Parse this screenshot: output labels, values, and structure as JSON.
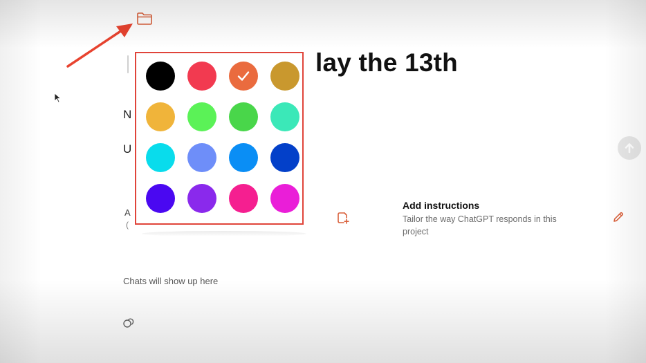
{
  "header": {
    "folder_icon": "folder-icon",
    "accent_color": "#d9603b"
  },
  "project": {
    "title_visible": "lay the 13th",
    "peek_1": "N",
    "peek_2": "U",
    "peek_3": "A",
    "peek_4": "("
  },
  "color_picker": {
    "selected_index": 2,
    "swatches": [
      {
        "color": "#000000"
      },
      {
        "color": "#f23a50"
      },
      {
        "color": "#ea6b3e"
      },
      {
        "color": "#c9982e"
      },
      {
        "color": "#f0b43a"
      },
      {
        "color": "#5bf257"
      },
      {
        "color": "#49d64a"
      },
      {
        "color": "#3be8b8"
      },
      {
        "color": "#09dcec"
      },
      {
        "color": "#6e8ef9"
      },
      {
        "color": "#0a8ef5"
      },
      {
        "color": "#0340c9"
      },
      {
        "color": "#4a08f1"
      },
      {
        "color": "#8a29ec"
      },
      {
        "color": "#f51f90"
      },
      {
        "color": "#ea1ed8"
      }
    ],
    "border_color": "#e0443a"
  },
  "instructions": {
    "title": "Add instructions",
    "description": "Tailor the way ChatGPT responds in this project",
    "edit_icon": "pencil-icon",
    "add_file_icon": "add-file-icon"
  },
  "chats": {
    "empty_text": "Chats will show up here",
    "icon": "chat-bubbles-icon"
  },
  "scroll_button": {
    "icon": "arrow-up-icon"
  },
  "annotation": {
    "arrow_color": "#e8432f"
  }
}
